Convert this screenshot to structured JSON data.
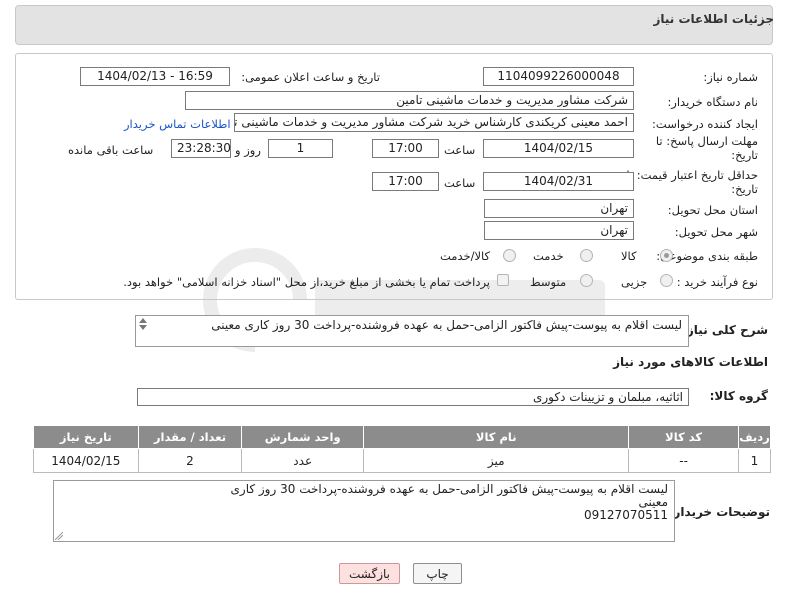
{
  "header": {
    "title": "جزئیات اطلاعات نیاز"
  },
  "fields": {
    "need_number_label": "شماره نیاز:",
    "need_number": "1104099226000048",
    "announce_label": "تاریخ و ساعت اعلان عمومی:",
    "announce_value": "1404/02/13 - 16:59",
    "buyer_org_label": "نام دستگاه خریدار:",
    "buyer_org": "شرکت مشاور مدیریت و خدمات ماشینی تامین",
    "creator_label": "ایجاد کننده درخواست:",
    "creator": "احمد معینی کریکندی کارشناس خرید شرکت مشاور مدیریت و خدمات ماشینی تامین",
    "buyer_contact_link": "اطلاعات تماس خریدار",
    "reply_deadline_label": "مهلت ارسال پاسخ: تا تاریخ:",
    "reply_date": "1404/02/15",
    "time_label": "ساعت",
    "reply_time": "17:00",
    "days_value": "1",
    "days_label": "روز و",
    "remaining_time": "23:28:30",
    "remaining_label": "ساعت باقی مانده",
    "price_validity_label": "حداقل تاریخ اعتبار قیمت: تا تاریخ:",
    "price_date": "1404/02/31",
    "price_time": "17:00",
    "province_label": "استان محل تحویل:",
    "province": "تهران",
    "city_label": "شهر محل تحویل:",
    "city": "تهران",
    "category_label": "طبقه بندی موضوعی:",
    "category_options": [
      "کالا",
      "خدمت",
      "کالا/خدمت"
    ],
    "process_label": "نوع فرآیند خرید :",
    "process_options": [
      "جزیی",
      "متوسط"
    ],
    "payment_note": "پرداخت تمام یا بخشی از مبلغ خرید،از محل \"اسناد خزانه اسلامی\" خواهد بود."
  },
  "description": {
    "label": "شرح کلی نیاز:",
    "text": "لیست اقلام به پیوست-پیش فاکتور الزامی-حمل به عهده فروشنده-پرداخت 30 روز کاری معینی"
  },
  "goods": {
    "section_title": "اطلاعات کالاهای مورد نیاز",
    "group_label": "گروه کالا:",
    "group_value": "اثاثیه، مبلمان و تزیینات دکوری"
  },
  "table": {
    "headers": [
      "ردیف",
      "کد کالا",
      "نام کالا",
      "واحد شمارش",
      "تعداد / مقدار",
      "تاریخ نیاز"
    ],
    "rows": [
      [
        "1",
        "--",
        "میز",
        "عدد",
        "2",
        "1404/02/15"
      ]
    ]
  },
  "buyer_notes": {
    "label": "توضیحات خریدار:",
    "line1": "لیست اقلام به پیوست-پیش فاکتور الزامی-حمل به عهده فروشنده-پرداخت 30 روز کاری",
    "line2": "معینی",
    "line3": "09127070511"
  },
  "buttons": {
    "print": "چاپ",
    "back": "بازگشت"
  },
  "colors": {
    "header_bg": "#e3e3e3",
    "table_header_bg": "#8c8c8c",
    "link": "#1a55c6",
    "back_button_bg": "#fde0e0"
  }
}
